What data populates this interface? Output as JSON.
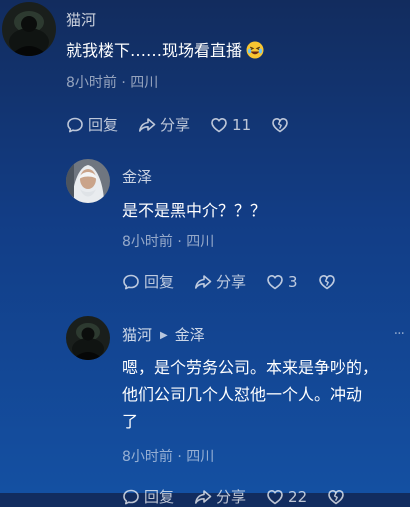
{
  "comments": [
    {
      "author": "猫河",
      "text": "就我楼下……现场看直播",
      "meta": "8小时前 · 四川",
      "reply_label": "回复",
      "share_label": "分享",
      "likes": "11"
    },
    {
      "author": "金泽",
      "text": "是不是黑中介？？？",
      "meta": "8小时前 · 四川",
      "reply_label": "回复",
      "share_label": "分享",
      "likes": "3"
    },
    {
      "author": "猫河",
      "reply_to": "金泽",
      "text_lines": [
        "嗯，是个劳务公司。本来是争吵的，",
        "他们公司几个人怼他一个人。冲动",
        "了"
      ],
      "meta": "8小时前 · 四川",
      "reply_label": "回复",
      "share_label": "分享",
      "likes": "22"
    }
  ],
  "colors": {
    "background_top": "#122c5e",
    "background_bottom": "#1450a2",
    "secondary_text": "#b9c4d8"
  },
  "icons": [
    "reply-bubble-icon",
    "share-arrow-icon",
    "heart-icon",
    "broken-heart-icon",
    "laughing-emoji-icon",
    "more-dots-icon"
  ]
}
